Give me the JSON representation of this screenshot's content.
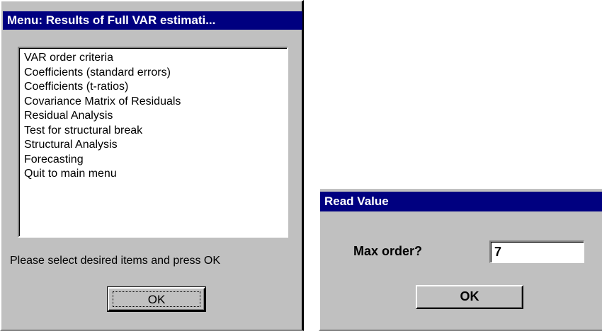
{
  "menu_window": {
    "title": "Menu: Results of Full VAR estimati...",
    "items": [
      "VAR order criteria",
      "Coefficients (standard errors)",
      "Coefficients (t-ratios)",
      "Covariance Matrix of Residuals",
      "Residual Analysis",
      "Test for structural break",
      "Structural Analysis",
      "Forecasting",
      "Quit to main menu"
    ],
    "prompt": "Please select desired items and press OK",
    "ok_label": "OK"
  },
  "read_value_window": {
    "title": "Read Value",
    "label": "Max order?",
    "input_value": "7",
    "ok_label": "OK"
  },
  "colors": {
    "titlebar_bg": "#000080",
    "window_bg": "#c0c0c0"
  }
}
